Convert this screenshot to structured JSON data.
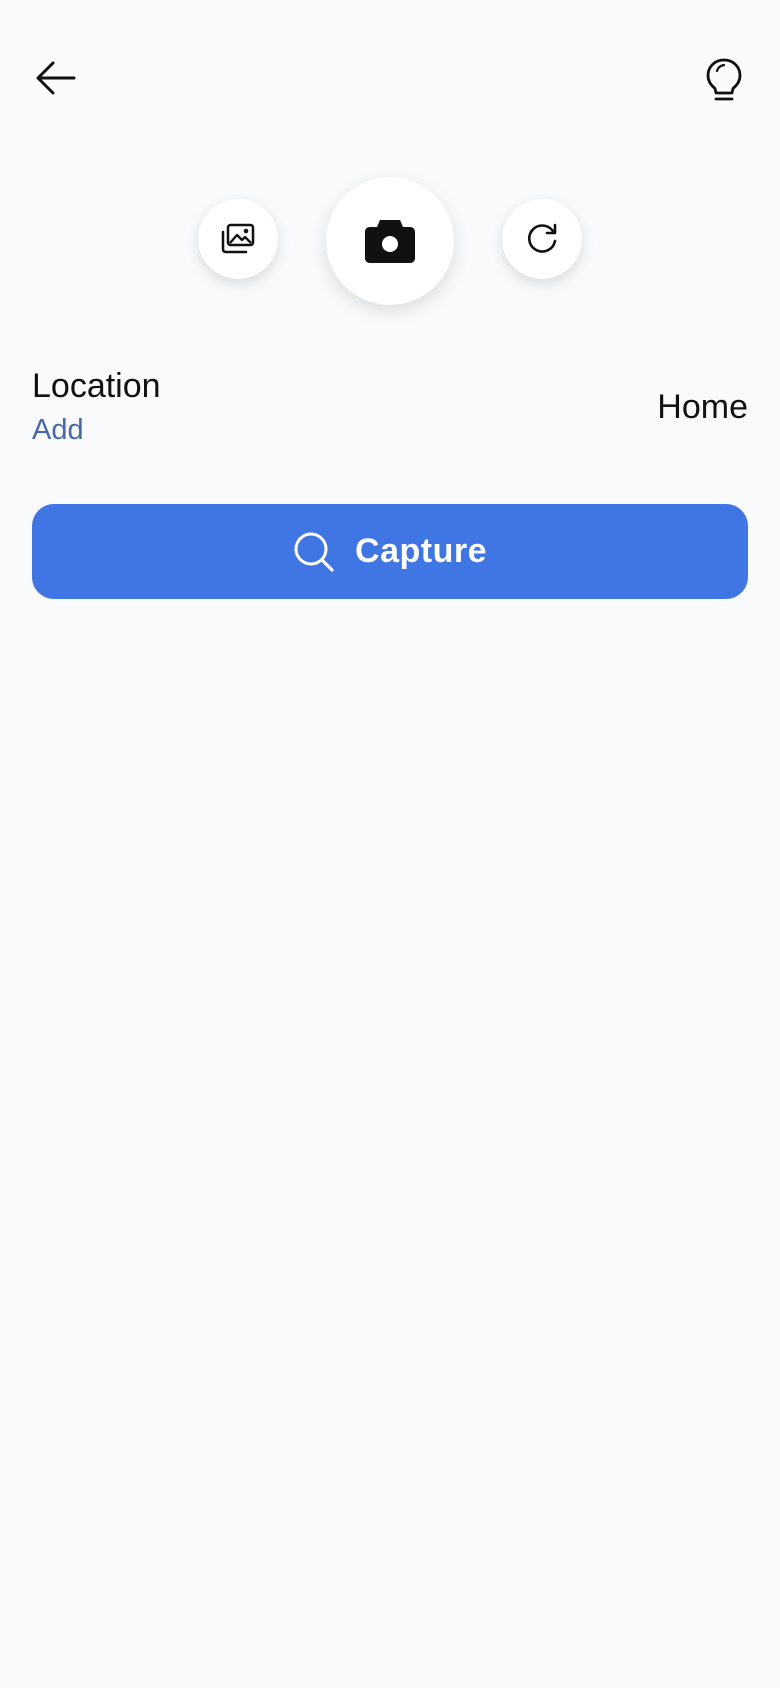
{
  "header": {
    "back_icon": "arrow-left-icon",
    "tips_icon": "lightbulb-icon"
  },
  "camera_controls": {
    "gallery_icon": "photo-gallery-icon",
    "capture_icon": "camera-icon",
    "rotate_icon": "rotate-icon"
  },
  "location": {
    "label": "Location",
    "add_label": "Add",
    "value": "Home"
  },
  "capture_button": {
    "label": "Capture",
    "icon": "search-icon",
    "color": "#4075e4"
  },
  "colors": {
    "background": "#f8fafc",
    "link": "#4a68a8",
    "text": "#111111"
  }
}
